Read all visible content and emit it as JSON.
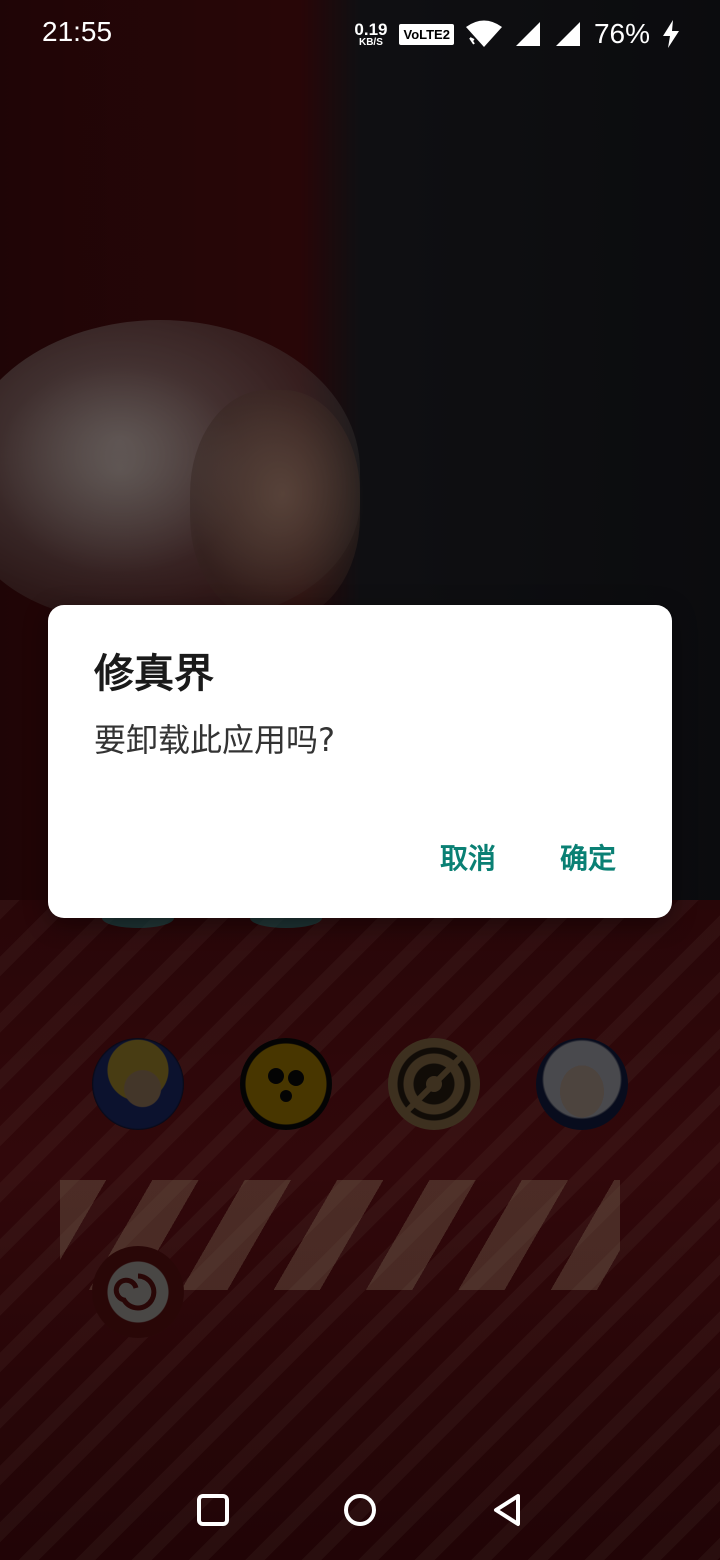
{
  "status_bar": {
    "time": "21:55",
    "net_speed_value": "0.19",
    "net_speed_unit": "KB/S",
    "volte_label": "VoLTE2",
    "battery_percent": "76%",
    "icons": [
      "wifi-icon",
      "signal-icon",
      "signal-icon",
      "charging-icon"
    ]
  },
  "dialog": {
    "title": "修真界",
    "message": "要卸载此应用吗?",
    "cancel_label": "取消",
    "confirm_label": "确定",
    "accent_color": "#0a8074"
  },
  "home_icons": [
    "hok-app-icon",
    "brawl-app-icon",
    "target-app-icon",
    "anime-app-icon",
    "swirl-app-icon"
  ],
  "nav_bar": {
    "icons": [
      "recents-icon",
      "home-icon",
      "back-icon"
    ]
  }
}
